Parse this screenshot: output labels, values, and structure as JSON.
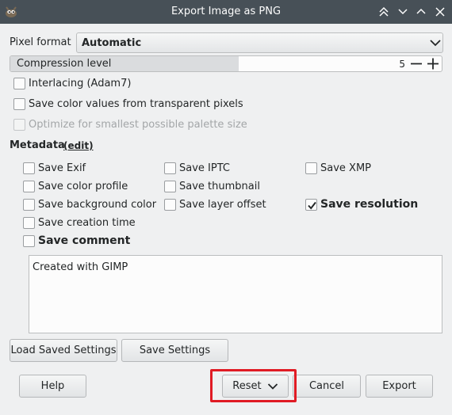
{
  "window": {
    "title": "Export Image as PNG",
    "controls": [
      "keep-above-icon",
      "keep-below-icon",
      "minimize-icon",
      "maximize-icon"
    ]
  },
  "pixel_format": {
    "label": "Pixel format",
    "value": "Automatic"
  },
  "compression": {
    "label": "Compression level",
    "value": "5",
    "level_fraction": 0.53
  },
  "options": {
    "interlacing": {
      "label": "Interlacing (Adam7)",
      "checked": false
    },
    "transparent": {
      "label": "Save color values from transparent pixels",
      "checked": false
    },
    "palette": {
      "label": "Optimize for smallest possible palette size",
      "checked": false,
      "enabled": false
    }
  },
  "metadata": {
    "heading": "Metadata",
    "edit_link": "(edit)",
    "exif": "Save Exif",
    "iptc": "Save IPTC",
    "xmp": "Save XMP",
    "color_profile": "Save color profile",
    "thumbnail": "Save thumbnail",
    "background": "Save background color",
    "layer_offset": "Save layer offset",
    "resolution": "Save resolution",
    "resolution_checked": true,
    "creation_time": "Save creation time",
    "comment": "Save comment",
    "comment_text": "Created with GIMP"
  },
  "buttons": {
    "load_settings": "Load Saved Settings",
    "save_settings": "Save Settings",
    "help": "Help",
    "reset": "Reset",
    "cancel": "Cancel",
    "export": "Export"
  },
  "colors": {
    "titlebar": "#475057",
    "highlight": "#e01b24",
    "background": "#eff0f1"
  }
}
